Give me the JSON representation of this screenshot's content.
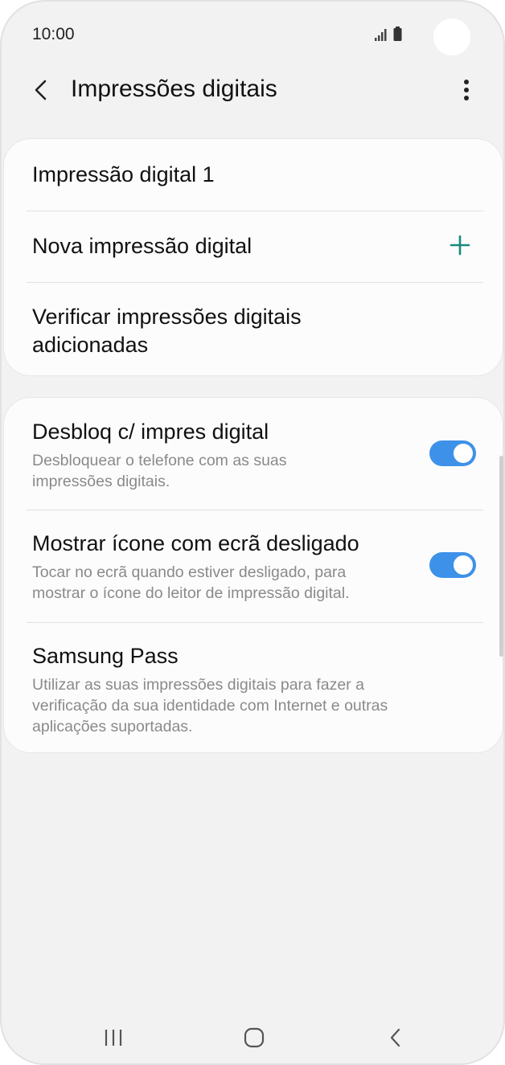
{
  "status_bar": {
    "time": "10:00",
    "icons": [
      "signal-icon",
      "battery-icon"
    ]
  },
  "app_bar": {
    "title": "Impressões digitais",
    "back_icon": "back-arrow-icon",
    "more_icon": "more-vert-icon"
  },
  "fingerprints_card": {
    "items": [
      {
        "title": "Impressão digital 1"
      },
      {
        "title": "Nova impressão digital",
        "icon": "plus-icon"
      },
      {
        "title_line1": "Verificar impressões digitais",
        "title_line2": "adicionadas"
      }
    ]
  },
  "settings_card": {
    "items": [
      {
        "title": "Desbloq c/ impres digital",
        "subtitle_line1": "Desbloquear o telefone com as suas",
        "subtitle_line2": "impressões digitais.",
        "toggle_on": true
      },
      {
        "title": "Mostrar ícone com ecrã desligado",
        "subtitle_line1": "Tocar no ecrã quando estiver desligado, para",
        "subtitle_line2": "mostrar o ícone do leitor de impressão digital.",
        "toggle_on": true
      },
      {
        "title": "Samsung Pass",
        "subtitle_line1": "Utilizar as suas impressões digitais para fazer a",
        "subtitle_line2": "verificação da sua identidade com Internet e outras",
        "subtitle_line3": "aplicações suportadas."
      }
    ]
  },
  "nav_bar": {
    "icons": [
      "recent-apps-icon",
      "home-icon",
      "back-icon"
    ]
  },
  "colors": {
    "accent": "#3e91e8",
    "plus": "#1a8a80",
    "background": "#f2f2f2",
    "card": "#fcfcfc"
  }
}
